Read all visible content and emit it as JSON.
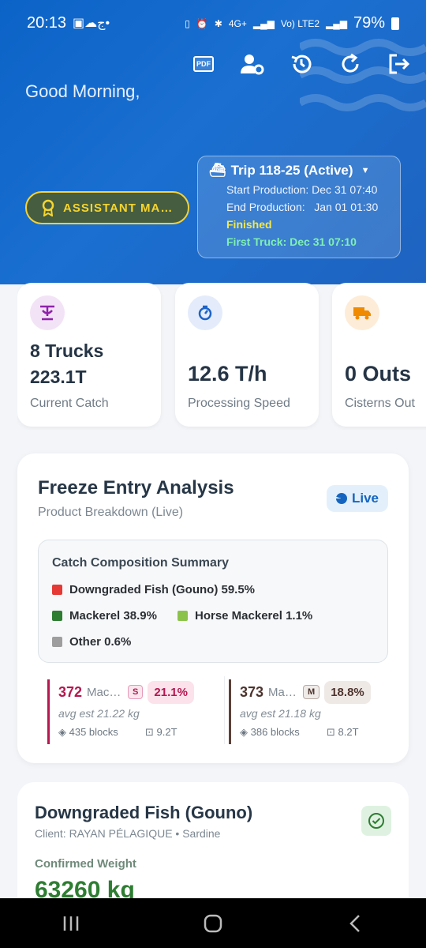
{
  "status_bar": {
    "time": "20:13",
    "left_icons": [
      "image-icon",
      "cloud-icon",
      "arabic-letter-icon",
      "dot-icon"
    ],
    "right_icons": [
      "battery-saver-icon",
      "alarm-icon",
      "bluetooth-icon",
      "4g-icon",
      "signal-icon",
      "volte-icon",
      "signal-icon"
    ],
    "network_4g": "4G+",
    "volte": "Vo) LTE2",
    "battery": "79%"
  },
  "toolbar": {
    "pdf_label": "PDF",
    "icons": [
      "pdf-icon",
      "user-settings-icon",
      "history-icon",
      "refresh-icon",
      "logout-icon"
    ]
  },
  "header": {
    "greeting": "Good Morning,",
    "role_label": "ASSISTANT MANAGER",
    "trip": {
      "title": "Trip 118-25 (Active)",
      "start": "Start Production: Dec 31 07:40",
      "end": "End Production:   Jan 01 01:30",
      "status": "Finished",
      "first_truck": "First Truck: Dec 31 07:10"
    }
  },
  "stats": [
    {
      "line1": "8 Trucks",
      "line2": "223.1T",
      "label": "Current Catch",
      "icon": "scale-icon"
    },
    {
      "line1": "12.6 T/h",
      "label": "Processing Speed",
      "icon": "timer-icon"
    },
    {
      "line1": "0 Outs",
      "label": "Cisterns Out",
      "icon": "truck-icon"
    }
  ],
  "freeze": {
    "title": "Freeze Entry Analysis",
    "subtitle": "Product Breakdown (Live)",
    "live_label": "Live",
    "composition": {
      "title": "Catch Composition Summary",
      "items": [
        {
          "label": "Downgraded Fish (Gouno) 59.5%",
          "color": "#e53935"
        },
        {
          "label": "Mackerel 38.9%",
          "color": "#2e7d32"
        },
        {
          "label": "Horse Mackerel 1.1%",
          "color": "#8bc34a"
        },
        {
          "label": "Other 0.6%",
          "color": "#9e9e9e"
        }
      ]
    },
    "lots": [
      {
        "count": "372",
        "name": "Mackerel",
        "size": "S",
        "pct": "21.1%",
        "avg": "avg est 21.22 kg",
        "blocks": "435 blocks",
        "weight": "9.2T",
        "color": "#b5174f"
      },
      {
        "count": "373",
        "name": "Mackerel",
        "size": "M",
        "pct": "18.8%",
        "avg": "avg est 21.18 kg",
        "blocks": "386 blocks",
        "weight": "8.2T",
        "color": "#5d4037"
      }
    ]
  },
  "product": {
    "title": "Downgraded Fish (Gouno)",
    "client": "Client: RAYAN PÉLAGIQUE • Sardine",
    "confirmed_label": "Confirmed Weight",
    "weight": "63260 kg"
  },
  "navbar": {
    "buttons": [
      "recent-apps-icon",
      "home-icon",
      "back-icon"
    ]
  }
}
